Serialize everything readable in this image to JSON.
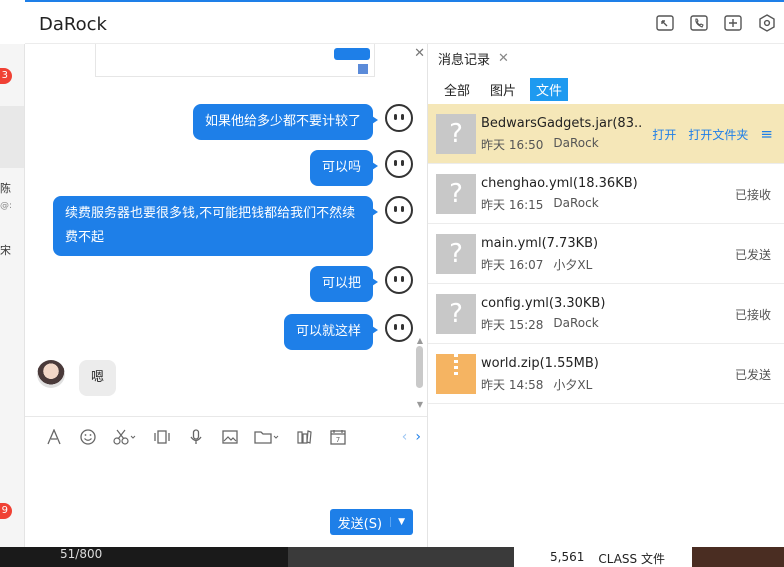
{
  "window": {
    "title": "DaRock"
  },
  "left_strip": {
    "badges": [
      "3",
      "9"
    ],
    "fragments": [
      "陈",
      "@:",
      "宋"
    ]
  },
  "chat": {
    "messages": [
      {
        "side": "out",
        "text": "如果他给多少都不要计较了"
      },
      {
        "side": "out",
        "text": "可以吗"
      },
      {
        "side": "out",
        "text": "续费服务器也要很多钱,不可能把钱都给我们不然续费不起"
      },
      {
        "side": "out",
        "text": "可以把"
      },
      {
        "side": "out",
        "text": "可以就这样"
      },
      {
        "side": "in",
        "text": "嗯"
      }
    ]
  },
  "input": {
    "send_label": "发送(S)"
  },
  "records": {
    "tab_label": "消息记录",
    "filters": [
      "全部",
      "图片",
      "文件"
    ],
    "active_filter": "文件",
    "files": [
      {
        "name": "BedwarsGadgets.jar(83....",
        "time": "昨天 16:50",
        "sender": "DaRock",
        "status": "",
        "actions": [
          "打开",
          "打开文件夹"
        ],
        "type": "unknown",
        "highlight": true
      },
      {
        "name": "chenghao.yml(18.36KB)",
        "time": "昨天 16:15",
        "sender": "DaRock",
        "status": "已接收",
        "type": "unknown"
      },
      {
        "name": "main.yml(7.73KB)",
        "time": "昨天 16:07",
        "sender": "小夕XL",
        "status": "已发送",
        "type": "unknown"
      },
      {
        "name": "config.yml(3.30KB)",
        "time": "昨天 15:28",
        "sender": "DaRock",
        "status": "已接收",
        "type": "unknown"
      },
      {
        "name": "world.zip(1.55MB)",
        "time": "昨天 14:58",
        "sender": "小夕XL",
        "status": "已发送",
        "type": "zip"
      }
    ]
  },
  "background_strip": {
    "left_text": "51/800",
    "count": "5,561",
    "type_label": "CLASS 文件"
  },
  "colors": {
    "accent": "#1e7fe8",
    "highlight_row": "#f5e7b8"
  }
}
